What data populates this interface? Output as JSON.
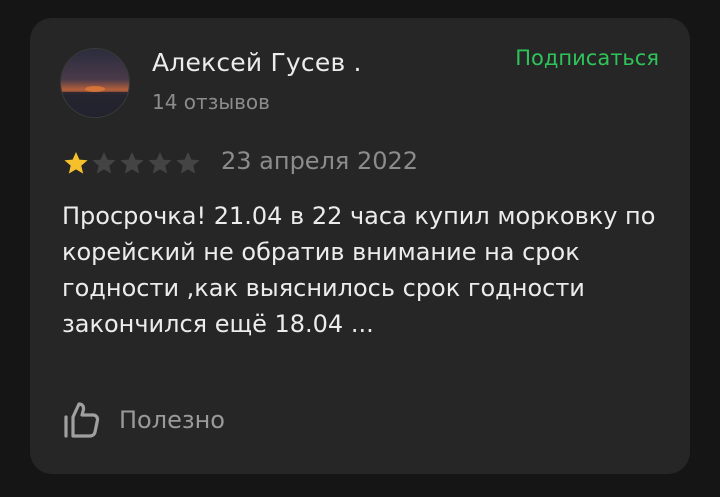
{
  "author": {
    "name": "Алексей Гусев .",
    "reviews_count": "14 отзывов"
  },
  "subscribe_label": "Подписаться",
  "rating": {
    "value": 1,
    "max": 5
  },
  "review": {
    "date": "23 апреля 2022",
    "text": "Просрочка! 21.04 в 22 часа купил морковку по корейский не обратив внимание на срок годности ,как выяснилось срок годности закончился ещё 18.04 ..."
  },
  "helpful_label": "Полезно",
  "colors": {
    "background": "#151515",
    "card": "#262626",
    "accent_green": "#2ec45a",
    "star_filled": "#f5c02c",
    "star_empty": "#444444"
  },
  "icons": [
    "avatar-photo",
    "star-icon",
    "thumbs-up-icon"
  ]
}
